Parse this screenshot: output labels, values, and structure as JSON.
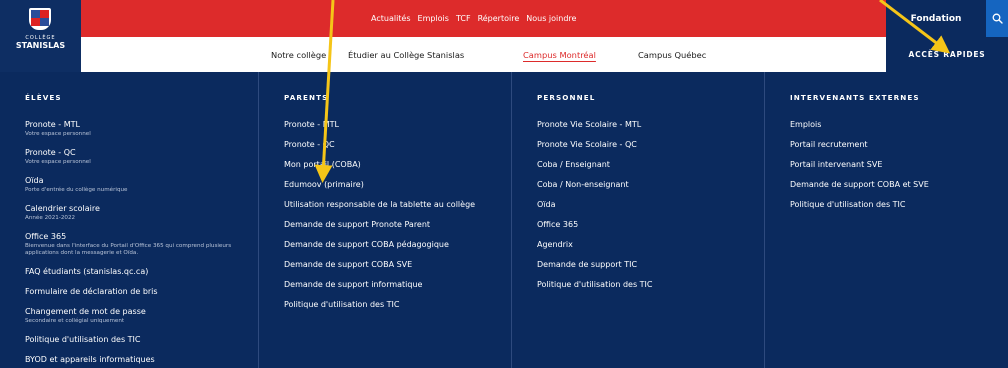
{
  "logo": {
    "small_text": "COLLÈGE",
    "name": "STANISLAS"
  },
  "topbar": {
    "links": [
      "Actualités",
      "Emplois",
      "TCF",
      "Répertoire",
      "Nous joindre"
    ],
    "fondation": "Fondation"
  },
  "nav": {
    "items": [
      "Notre collège",
      "Étudier au Collège Stanislas",
      "Campus Montréal",
      "Campus Québec"
    ],
    "active": "Campus Montréal",
    "acces": "ACCÈS RAPIDES"
  },
  "menu": {
    "eleves": {
      "heading": "ÉLÈVES",
      "items": [
        {
          "label": "Pronote - MTL",
          "sub": "Votre espace personnel"
        },
        {
          "label": "Pronote - QC",
          "sub": "Votre espace personnel"
        },
        {
          "label": "Oïda",
          "sub": "Porte d'entrée du collège numérique"
        },
        {
          "label": "Calendrier scolaire",
          "sub": "Année 2021-2022"
        },
        {
          "label": "Office 365",
          "sub": "Bienvenue dans l'interface du Portail d'Office 365 qui comprend plusieurs applications dont la messagerie et Oïda."
        },
        {
          "label": "FAQ étudiants (stanislas.qc.ca)",
          "sub": ""
        },
        {
          "label": "Formulaire de déclaration de bris",
          "sub": ""
        },
        {
          "label": "Changement de mot de passe",
          "sub": "Secondaire et collégial uniquement"
        },
        {
          "label": "Politique d'utilisation des TIC",
          "sub": ""
        },
        {
          "label": "BYOD et appareils informatiques",
          "sub": ""
        }
      ]
    },
    "parents": {
      "heading": "PARENTS",
      "items": [
        "Pronote - MTL",
        "Pronote - QC",
        "Mon portail (COBA)",
        "Edumoov (primaire)",
        "Utilisation responsable de la tablette au collège",
        "Demande de support Pronote Parent",
        "Demande de support COBA pédagogique",
        "Demande de support COBA SVE",
        "Demande de support informatique",
        "Politique d'utilisation des TIC"
      ]
    },
    "personnel": {
      "heading": "PERSONNEL",
      "items": [
        "Pronote Vie Scolaire - MTL",
        "Pronote Vie Scolaire - QC",
        "Coba / Enseignant",
        "Coba / Non-enseignant",
        "Oïda",
        "Office 365",
        "Agendrix",
        "Demande de support TIC",
        "Politique d'utilisation des TIC"
      ]
    },
    "externes": {
      "heading": "INTERVENANTS EXTERNES",
      "items": [
        "Emplois",
        "Portail recrutement",
        "Portail intervenant SVE",
        "Demande de support COBA et SVE",
        "Politique d'utilisation des TIC"
      ]
    }
  },
  "colors": {
    "red": "#dd2b2b",
    "navy": "#0b2a5e",
    "annotation": "#f5c518",
    "search": "#1565c0"
  },
  "icons": {
    "search": "search-icon",
    "logo": "shield-logo-icon"
  }
}
